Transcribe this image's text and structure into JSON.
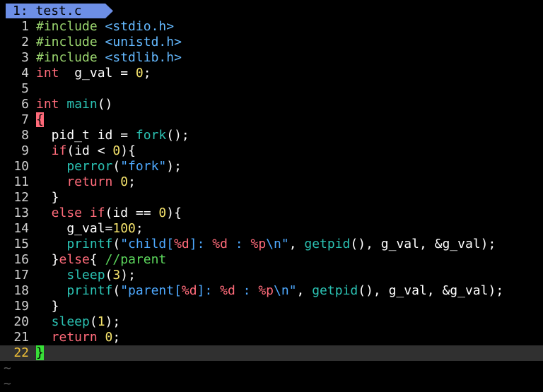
{
  "tab": {
    "number": "1:",
    "filename": "test.c"
  },
  "colors": {
    "tab_bg": "#6d8fe6",
    "keyword": "#ff6b7a",
    "function": "#2bc2b3",
    "number": "#f5e36c",
    "string": "#4ea9ff",
    "comment": "#5cd65c",
    "preprocessor": "#9bd66f",
    "cursor": "#38e038"
  },
  "editor": {
    "current_line": 22,
    "lines": [
      {
        "n": "1",
        "tokens": [
          [
            "pp",
            "#include "
          ],
          [
            "inc",
            "<stdio.h>"
          ]
        ]
      },
      {
        "n": "2",
        "tokens": [
          [
            "pp",
            "#include "
          ],
          [
            "inc",
            "<unistd.h>"
          ]
        ]
      },
      {
        "n": "3",
        "tokens": [
          [
            "pp",
            "#include "
          ],
          [
            "inc",
            "<stdlib.h>"
          ]
        ]
      },
      {
        "n": "4",
        "tokens": [
          [
            "ty",
            "int"
          ],
          [
            "",
            "  g_val = "
          ],
          [
            "num",
            "0"
          ],
          [
            "",
            ";"
          ]
        ]
      },
      {
        "n": "5",
        "tokens": []
      },
      {
        "n": "6",
        "tokens": [
          [
            "ty",
            "int"
          ],
          [
            "",
            " "
          ],
          [
            "fn",
            "main"
          ],
          [
            "",
            "()"
          ]
        ]
      },
      {
        "n": "7",
        "tokens": [
          [
            "brace-hl",
            "{"
          ]
        ]
      },
      {
        "n": "8",
        "tokens": [
          [
            "",
            "  pid_t id = "
          ],
          [
            "fn",
            "fork"
          ],
          [
            "",
            "();"
          ]
        ]
      },
      {
        "n": "9",
        "tokens": [
          [
            "kw",
            "  if"
          ],
          [
            "",
            "(id < "
          ],
          [
            "num",
            "0"
          ],
          [
            "",
            "){"
          ]
        ]
      },
      {
        "n": "10",
        "tokens": [
          [
            "fn",
            "    perror"
          ],
          [
            "",
            "("
          ],
          [
            "str",
            "\"fork\""
          ],
          [
            "",
            ");"
          ]
        ]
      },
      {
        "n": "11",
        "tokens": [
          [
            "kw",
            "    return"
          ],
          [
            "",
            " "
          ],
          [
            "num",
            "0"
          ],
          [
            "",
            ";"
          ]
        ]
      },
      {
        "n": "12",
        "tokens": [
          [
            "",
            "  }"
          ]
        ]
      },
      {
        "n": "13",
        "tokens": [
          [
            "kw",
            "  else if"
          ],
          [
            "",
            "(id == "
          ],
          [
            "num",
            "0"
          ],
          [
            "",
            "){"
          ]
        ]
      },
      {
        "n": "14",
        "tokens": [
          [
            "",
            "    g_val="
          ],
          [
            "num",
            "100"
          ],
          [
            "",
            ";"
          ]
        ]
      },
      {
        "n": "15",
        "tokens": [
          [
            "fn",
            "    printf"
          ],
          [
            "",
            "("
          ],
          [
            "str",
            "\"child["
          ],
          [
            "fmt",
            "%d"
          ],
          [
            "str",
            "]: "
          ],
          [
            "fmt",
            "%d"
          ],
          [
            "str",
            " : "
          ],
          [
            "fmt",
            "%p"
          ],
          [
            "str",
            "\\n\""
          ],
          [
            "",
            ", "
          ],
          [
            "fn",
            "getpid"
          ],
          [
            "",
            "(), g_val, &g_val);"
          ]
        ]
      },
      {
        "n": "16",
        "tokens": [
          [
            "",
            "  }"
          ],
          [
            "kw",
            "else"
          ],
          [
            "",
            "{ "
          ],
          [
            "cmt",
            "//parent"
          ]
        ]
      },
      {
        "n": "17",
        "tokens": [
          [
            "fn",
            "    sleep"
          ],
          [
            "",
            "("
          ],
          [
            "num",
            "3"
          ],
          [
            "",
            ");"
          ]
        ]
      },
      {
        "n": "18",
        "tokens": [
          [
            "fn",
            "    printf"
          ],
          [
            "",
            "("
          ],
          [
            "str",
            "\"parent["
          ],
          [
            "fmt",
            "%d"
          ],
          [
            "str",
            "]: "
          ],
          [
            "fmt",
            "%d"
          ],
          [
            "str",
            " : "
          ],
          [
            "fmt",
            "%p"
          ],
          [
            "str",
            "\\n\""
          ],
          [
            "",
            ", "
          ],
          [
            "fn",
            "getpid"
          ],
          [
            "",
            "(), g_val, &g_val);"
          ]
        ]
      },
      {
        "n": "19",
        "tokens": [
          [
            "",
            "  }"
          ]
        ]
      },
      {
        "n": "20",
        "tokens": [
          [
            "fn",
            "  sleep"
          ],
          [
            "",
            "("
          ],
          [
            "num",
            "1"
          ],
          [
            "",
            ");"
          ]
        ]
      },
      {
        "n": "21",
        "tokens": [
          [
            "kw",
            "  return"
          ],
          [
            "",
            " "
          ],
          [
            "num",
            "0"
          ],
          [
            "",
            ";"
          ]
        ]
      },
      {
        "n": "22",
        "tokens": [
          [
            "brace-cur",
            "}"
          ]
        ]
      }
    ],
    "filler": [
      "~",
      "~"
    ]
  }
}
